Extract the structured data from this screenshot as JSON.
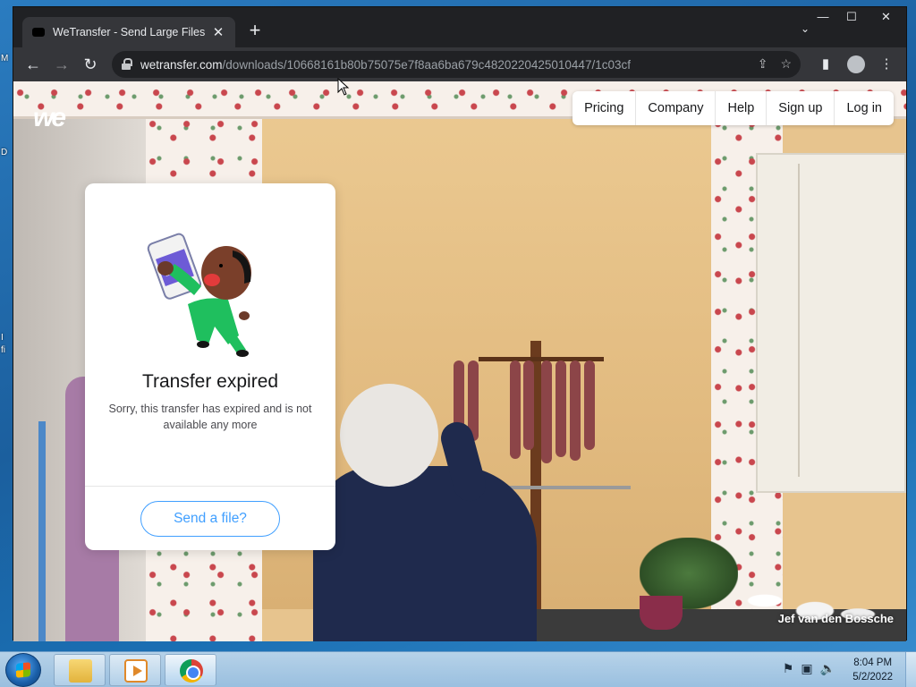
{
  "desktop": {
    "fragments": [
      "M",
      "D",
      "I",
      "fi"
    ]
  },
  "browser": {
    "tab": {
      "title": "WeTransfer - Send Large Files & Sh",
      "close_glyph": "✕"
    },
    "new_tab_glyph": "+",
    "tab_search_glyph": "⌄",
    "window_controls": {
      "minimize": "—",
      "maximize": "☐",
      "close": "✕"
    },
    "nav": {
      "back": "←",
      "forward": "→",
      "reload": "↻"
    },
    "address": {
      "host": "wetransfer.com",
      "path": "/downloads/10668161b80b75075e7f8aa6ba679c4820220425010447/1c03cf"
    },
    "omni_icons": {
      "share": "⇪",
      "bookmark": "☆"
    },
    "toolbar_icons": {
      "side_panel": "▮",
      "menu": "⋮"
    }
  },
  "page": {
    "logo": "we",
    "nav": [
      "Pricing",
      "Company",
      "Help",
      "Sign up",
      "Log in"
    ],
    "card": {
      "title": "Transfer expired",
      "message": "Sorry, this transfer has expired and is not available any more",
      "button": "Send a file?"
    },
    "credit": "Jef van den Bossche"
  },
  "taskbar": {
    "apps": [
      "file-explorer",
      "media-player",
      "chrome"
    ],
    "tray_icons": [
      "flag-icon",
      "network-icon",
      "volume-icon"
    ],
    "time": "8:04 PM",
    "date": "5/2/2022"
  },
  "colors": {
    "accent": "#409fff",
    "browser_dark": "#202124",
    "browser_mid": "#35363a",
    "wall": "#e7c48e"
  }
}
